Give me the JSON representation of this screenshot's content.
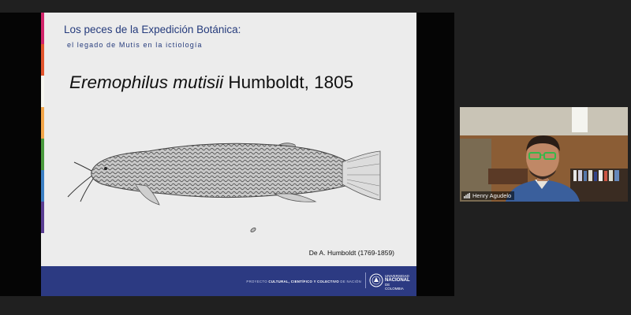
{
  "slide": {
    "title": "Los peces de la Expedición Botánica:",
    "subtitle": "el legado de Mutis en la ictiología",
    "species_name": "Eremophilus mutisii",
    "species_author": "Humboldt, 1805",
    "credit": "De A. Humboldt (1769-1859)",
    "strip_colors": [
      "#d2246a",
      "#e2552e",
      "#f6f6f0",
      "#f3a64a",
      "#4a9a3e",
      "#3c7fc4",
      "#5a3e93",
      "#ececec"
    ],
    "illustration_icon": "catfish-illustration"
  },
  "footer": {
    "project_prefix": "PROYECTO ",
    "project_bold": "CULTURAL, CIENTÍFICO Y COLECTIVO",
    "project_suffix": " DE NACIÓN",
    "logo_line1": "UNIVERSIDAD",
    "logo_line2": "NACIONAL",
    "logo_line3": "DE COLOMBIA",
    "logo_icon": "university-seal-icon",
    "background": "#2c3a82"
  },
  "participant": {
    "name": "Henry Agudelo",
    "indicator_icon": "audio-signal-icon"
  }
}
